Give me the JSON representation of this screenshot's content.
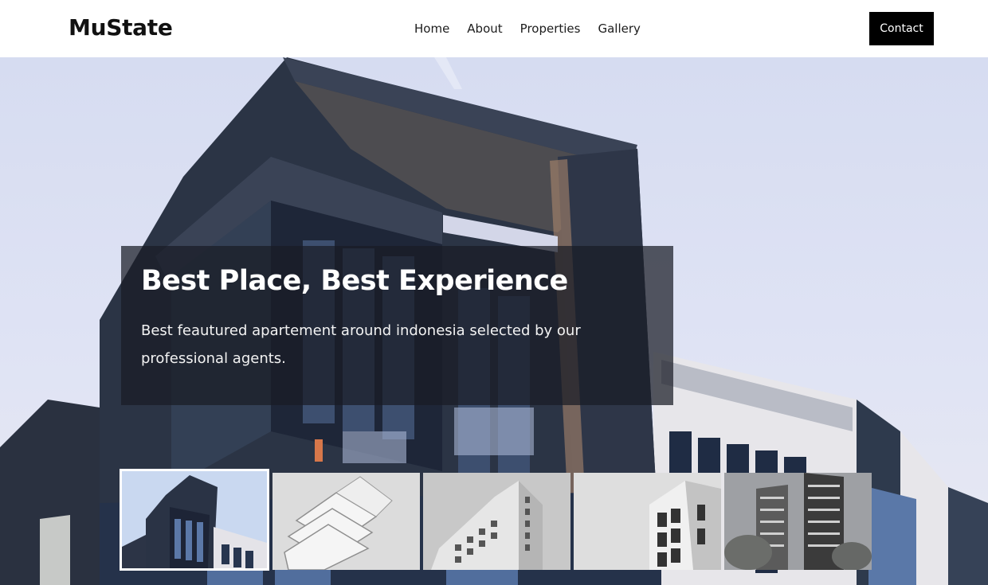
{
  "brand": {
    "name": "MuState"
  },
  "nav": {
    "items": [
      {
        "label": "Home"
      },
      {
        "label": "About"
      },
      {
        "label": "Properties"
      },
      {
        "label": "Gallery"
      }
    ],
    "contact_label": "Contact"
  },
  "hero": {
    "title": "Best Place, Best Experience",
    "description": "Best feautured apartement around indonesia selected by our professional agents.",
    "background_icon": "building-photo"
  },
  "gallery": {
    "active_index": 0,
    "thumbnails": [
      {
        "icon": "building-photo-1"
      },
      {
        "icon": "building-photo-2"
      },
      {
        "icon": "building-photo-3"
      },
      {
        "icon": "building-photo-4"
      },
      {
        "icon": "building-photo-5"
      }
    ]
  },
  "colors": {
    "header_bg": "#ffffff",
    "button_bg": "#000000",
    "button_text": "#ffffff",
    "caption_bg": "#191c26",
    "sky": "#d6dcf1"
  }
}
